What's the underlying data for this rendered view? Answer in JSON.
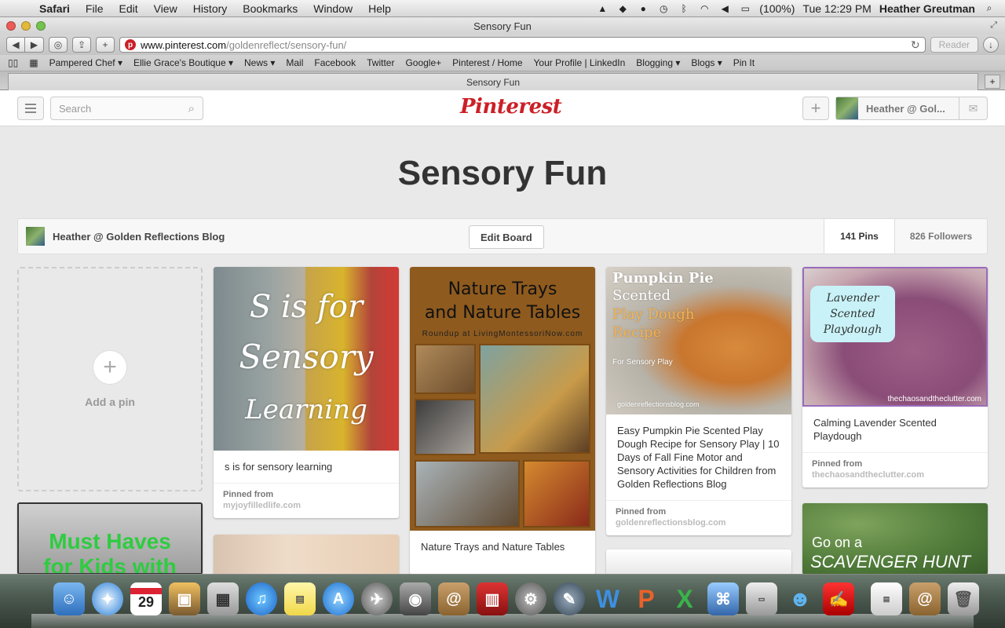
{
  "menubar": {
    "app": "Safari",
    "items": [
      "File",
      "Edit",
      "View",
      "History",
      "Bookmarks",
      "Window",
      "Help"
    ],
    "battery": "(100%)",
    "clock": "Tue 12:29 PM",
    "user": "Heather Greutman"
  },
  "window": {
    "title": "Sensory Fun",
    "tab_title": "Sensory Fun"
  },
  "toolbar": {
    "url_domain": "www.pinterest.com",
    "url_path": "/goldenreflect/sensory-fun/",
    "reader_label": "Reader"
  },
  "bookmarks": [
    "Pampered Chef ▾",
    "Ellie Grace's Boutique ▾",
    "News ▾",
    "Mail",
    "Facebook",
    "Twitter",
    "Google+",
    "Pinterest / Home",
    "Your Profile | LinkedIn",
    "Blogging ▾",
    "Blogs ▾",
    "Pin It"
  ],
  "pinterest": {
    "search_placeholder": "Search",
    "logo": "Pinterest",
    "user_name": "Heather @ Gol..."
  },
  "board": {
    "title": "Sensory Fun",
    "owner": "Heather @ Golden Reflections Blog",
    "edit_label": "Edit Board",
    "pins": "141 Pins",
    "followers": "826 Followers",
    "add_pin_label": "Add a pin"
  },
  "pins": [
    {
      "image_text": [
        "S is for",
        "Sensory",
        "Learning"
      ],
      "description": "s is for sensory learning",
      "pinned_label": "Pinned from",
      "source": "myjoyfilledlife.com"
    },
    {
      "image_text": [
        "Nature Trays",
        "and Nature Tables"
      ],
      "image_sub": "Roundup at LivingMontessoriNow.com",
      "description": "Nature Trays and Nature Tables"
    },
    {
      "image_text": [
        "Pumpkin Pie",
        "Scented",
        "Play Dough",
        "Recipe",
        "For Sensory Play",
        "goldenreflectionsblog.com"
      ],
      "description": "Easy Pumpkin Pie Scented Play Dough Recipe for Sensory Play | 10 Days of Fall Fine Motor and Sensory Activities for Children from Golden Reflections Blog",
      "pinned_label": "Pinned from",
      "source": "goldenreflectionsblog.com"
    },
    {
      "image_text": [
        "Lavender Scented",
        "Playdough"
      ],
      "image_watermark": "thechaosandtheclutter.com",
      "description": "Calming Lavender Scented Playdough",
      "pinned_label": "Pinned from",
      "source": "thechaosandtheclutter.com"
    }
  ],
  "more_pins": {
    "must_haves_text": [
      "Must Haves",
      "for Kids with"
    ],
    "scavenger_text": [
      "Go on a",
      "SCAVENGER HUNT for"
    ]
  },
  "dock": {
    "calendar_day": "29",
    "items": [
      "finder-icon",
      "safari-icon",
      "calendar-icon",
      "iphoto-icon",
      "calculator-icon",
      "itunes-icon",
      "stickies-icon",
      "app-store-icon",
      "launchpad-icon",
      "facetime-icon",
      "address-book-icon",
      "photo-booth-icon",
      "system-preferences-icon",
      "script-editor-icon",
      "word-icon",
      "powerpoint-icon",
      "excel-icon",
      "network-icon",
      "solution-menu-icon",
      "messenger-icon",
      "acrobat-icon",
      "pages-icon",
      "contacts-icon",
      "trash-icon"
    ]
  },
  "colors": {
    "pinterest_red": "#cb2027",
    "green_text": "#2ecc40"
  }
}
